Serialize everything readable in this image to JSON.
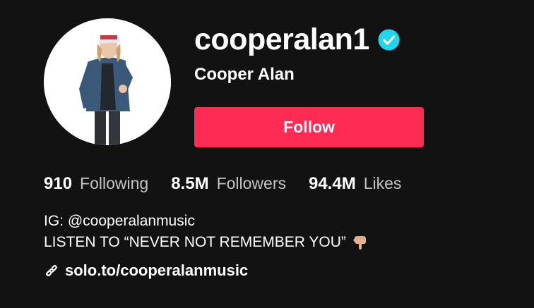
{
  "profile": {
    "username": "cooperalan1",
    "display_name": "Cooper Alan",
    "verified": true
  },
  "actions": {
    "follow_label": "Follow"
  },
  "stats": {
    "following": {
      "value": "910",
      "label": "Following"
    },
    "followers": {
      "value": "8.5M",
      "label": "Followers"
    },
    "likes": {
      "value": "94.4M",
      "label": "Likes"
    }
  },
  "bio": {
    "line1": "IG: @cooperalanmusic",
    "line2": "LISTEN TO “NEVER NOT REMEMBER YOU”",
    "emoji_icon": "backhand-index-pointing-down-icon"
  },
  "link": {
    "text": "solo.to/cooperalanmusic",
    "icon": "link-icon"
  },
  "colors": {
    "background": "#121212",
    "follow_button": "#fe2c55",
    "verified_badge": "#20d5ec"
  }
}
